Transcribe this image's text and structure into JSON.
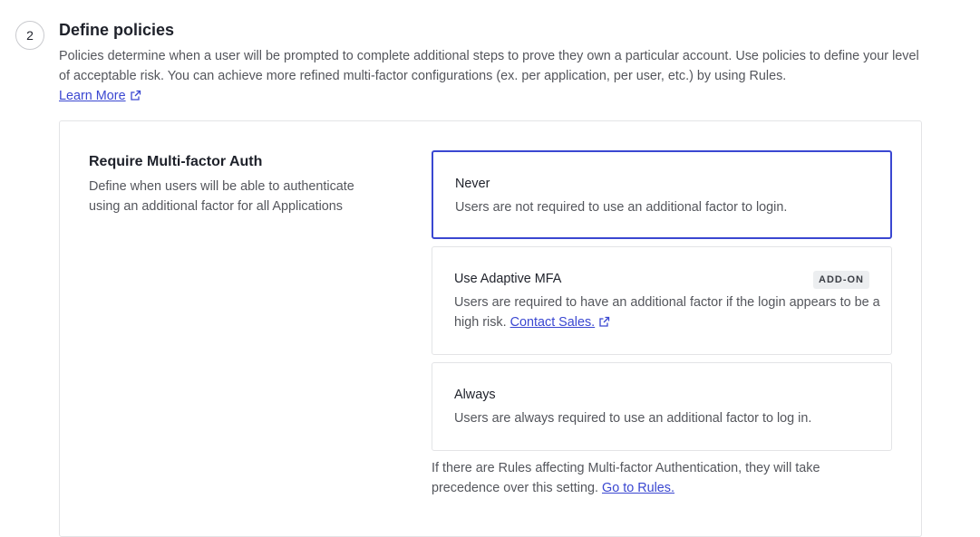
{
  "step": {
    "number": "2",
    "title": "Define policies",
    "description": "Policies determine when a user will be prompted to complete additional steps to prove they own a particular account. Use policies to define your level of acceptable risk. You can achieve more refined multi-factor configurations (ex. per application, per user, etc.) by using Rules.",
    "learn_more": "Learn More"
  },
  "mfa": {
    "title": "Require Multi-factor Auth",
    "description": "Define when users will be able to authenticate using an additional factor for all Applications",
    "options": [
      {
        "title": "Never",
        "description": "Users are not required to use an additional factor to login.",
        "selected": true
      },
      {
        "title": "Use Adaptive MFA",
        "badge": "ADD-ON",
        "description": "Users are required to have an additional factor if the login appears to be a high risk.",
        "link": "Contact Sales."
      },
      {
        "title": "Always",
        "description": "Users are always required to use an additional factor to log in."
      }
    ],
    "footer_note": "If there are Rules affecting Multi-factor Authentication, they will take precedence over this setting.",
    "footer_link": "Go to Rules."
  },
  "colors": {
    "accent": "#3a47d1",
    "text": "#1e212a",
    "muted": "#54565c",
    "border": "#e3e4e6"
  },
  "icons": {
    "external_link": "external-link-icon"
  }
}
